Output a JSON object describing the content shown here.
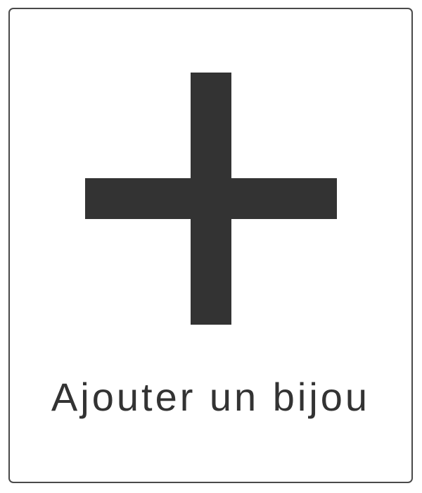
{
  "add_card": {
    "label": "Ajouter un bijou",
    "icon": "plus-icon",
    "icon_color": "#333333",
    "border_color": "#4a4a4a"
  }
}
